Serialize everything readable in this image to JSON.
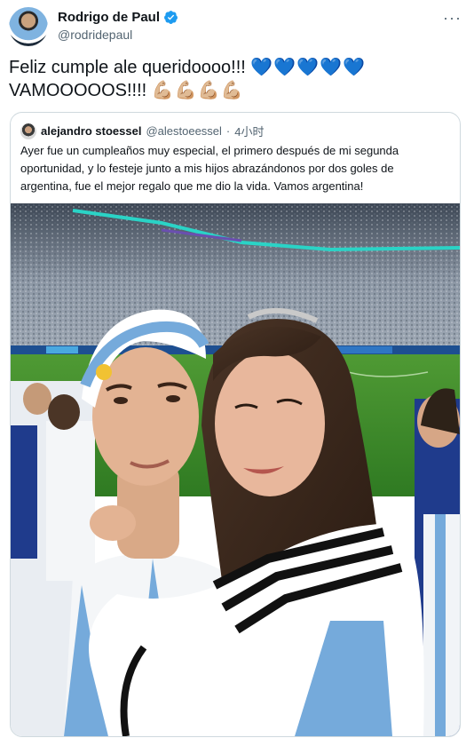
{
  "author": {
    "name": "Rodrigo de Paul",
    "handle": "@rodridepaul"
  },
  "more_label": "···",
  "tweet": {
    "line1": "Feliz cumple ale queridoooo!!! ",
    "hearts": "💙💙💙💙💙",
    "line2": "VAMOOOOOS!!!! ",
    "arms": "💪🏼💪🏼💪🏼💪🏼"
  },
  "quote": {
    "name": "alejandro stoessel",
    "handle": "@alestoeessel",
    "separator": "·",
    "time": "4小时",
    "text": "Ayer fue un cumpleaños muy especial, el primero después de mi segunda oportunidad, y lo festeje junto a mis hijos abrazándonos por dos goles de argentina, fue el mejor regalo que me dio la vida. Vamos argentina!"
  },
  "colors": {
    "verified": "#1d9bf0",
    "pitch": "#3f8f2a",
    "argentina_blue": "#75aadb"
  }
}
